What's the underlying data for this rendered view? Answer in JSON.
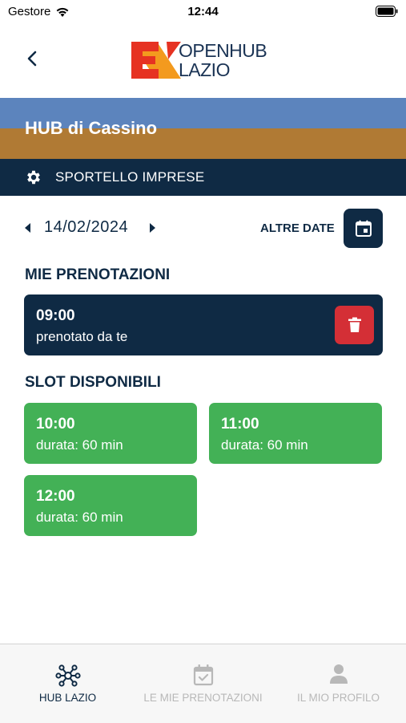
{
  "status_bar": {
    "carrier": "Gestore",
    "time": "12:44"
  },
  "header": {
    "logo_line1": "OPENHUB",
    "logo_line2": "LAZIO"
  },
  "hub": {
    "title": "HUB di Cassino"
  },
  "service": {
    "label": "SPORTELLO IMPRESE",
    "icon": "gear-icon"
  },
  "date_nav": {
    "date": "14/02/2024",
    "other_dates_label": "ALTRE DATE",
    "calendar_icon": "calendar-icon"
  },
  "my_bookings": {
    "title": "MIE PRENOTAZIONI",
    "items": [
      {
        "time": "09:00",
        "note": "prenotato da te"
      }
    ]
  },
  "available_slots": {
    "title": "SLOT DISPONIBILI",
    "items": [
      {
        "time": "10:00",
        "duration": "durata: 60 min"
      },
      {
        "time": "11:00",
        "duration": "durata: 60 min"
      },
      {
        "time": "12:00",
        "duration": "durata: 60 min"
      }
    ]
  },
  "tab_bar": {
    "tabs": [
      {
        "label": "HUB LAZIO",
        "icon": "network-icon",
        "active": true
      },
      {
        "label": "LE MIE PRENOTAZIONI",
        "icon": "calendar-check-icon",
        "active": false
      },
      {
        "label": "IL MIO PROFILO",
        "icon": "person-icon",
        "active": false
      }
    ]
  },
  "colors": {
    "primary": "#0f2a44",
    "slot_green": "#43b156",
    "delete_red": "#d42f36",
    "banner_blue": "#5c84bd",
    "banner_gold": "#b07a34"
  }
}
